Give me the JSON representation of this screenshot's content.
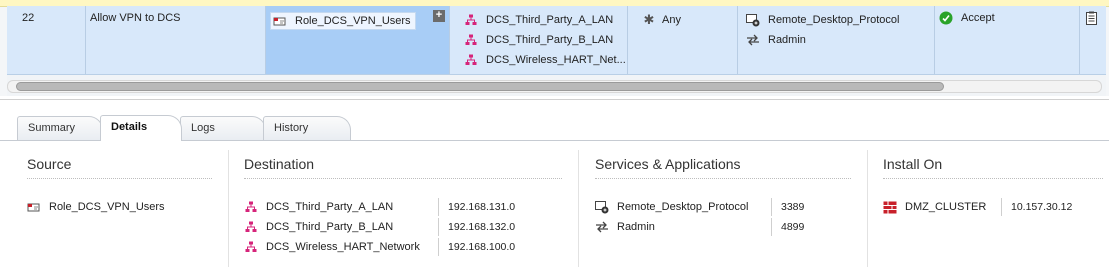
{
  "rule": {
    "number": "22",
    "name": "Allow VPN to DCS",
    "source": "Role_DCS_VPN_Users",
    "add_symbol": "+",
    "destinations": [
      "DCS_Third_Party_A_LAN",
      "DCS_Third_Party_B_LAN",
      "DCS_Wireless_HART_Net..."
    ],
    "vpn": "Any",
    "services": [
      "Remote_Desktop_Protocol",
      "Radmin"
    ],
    "action": "Accept"
  },
  "tabs": [
    "Summary",
    "Details",
    "Logs",
    "History"
  ],
  "active_tab": "Details",
  "details": {
    "source": {
      "title": "Source",
      "items": [
        "Role_DCS_VPN_Users"
      ]
    },
    "destination": {
      "title": "Destination",
      "items": [
        {
          "name": "DCS_Third_Party_A_LAN",
          "ip": "192.168.131.0"
        },
        {
          "name": "DCS_Third_Party_B_LAN",
          "ip": "192.168.132.0"
        },
        {
          "name": "DCS_Wireless_HART_Network",
          "ip": "192.168.100.0"
        }
      ]
    },
    "services": {
      "title": "Services & Applications",
      "items": [
        {
          "name": "Remote_Desktop_Protocol",
          "port": "3389"
        },
        {
          "name": "Radmin",
          "port": "4899"
        }
      ]
    },
    "install_on": {
      "title": "Install On",
      "items": [
        {
          "name": "DMZ_CLUSTER",
          "ip": "10.157.30.12"
        }
      ]
    }
  },
  "icons": {
    "role": "role-icon",
    "network": "network-icon",
    "any": "asterisk-icon",
    "rdp_service": "remote-desktop-service-icon",
    "radmin_service": "radmin-service-icon",
    "accept": "accept-icon",
    "track": "log-icon",
    "cluster": "firewall-cluster-icon"
  },
  "colors": {
    "selected_row": "#d8e8fa",
    "selected_cell": "#a8cdf6",
    "network_icon": "#d6247a",
    "accept": "#2aa32a",
    "firewall": "#c8202a"
  }
}
